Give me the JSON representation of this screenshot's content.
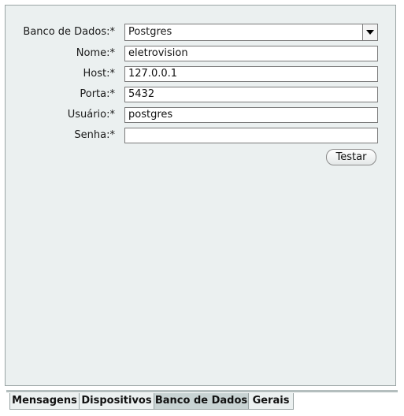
{
  "form": {
    "database_label": "Banco de Dados:*",
    "database_value": "Postgres",
    "name_label": "Nome:*",
    "name_value": "eletrovision",
    "host_label": "Host:*",
    "host_value": "127.0.0.1",
    "port_label": "Porta:*",
    "port_value": "5432",
    "user_label": "Usuário:*",
    "user_value": "postgres",
    "password_label": "Senha:*",
    "password_value": "",
    "test_button": "Testar"
  },
  "tabs": [
    {
      "label": "Mensagens",
      "active": false
    },
    {
      "label": "Dispositivos",
      "active": false
    },
    {
      "label": "Banco de Dados",
      "active": true
    },
    {
      "label": "Gerais",
      "active": false
    }
  ]
}
